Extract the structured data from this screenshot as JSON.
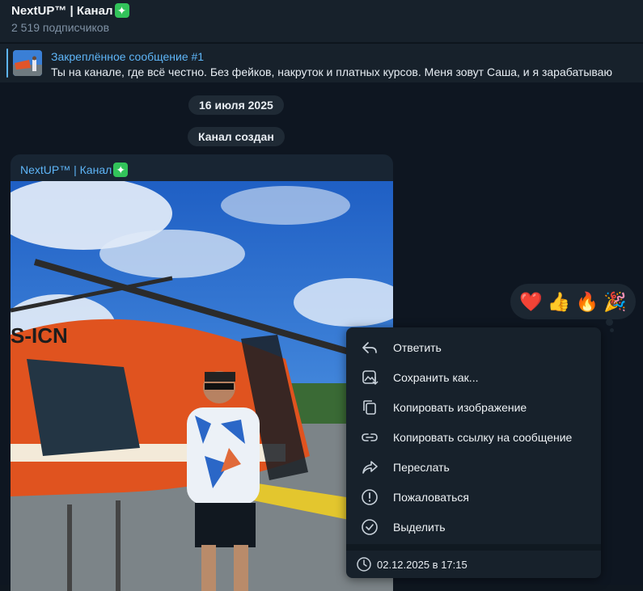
{
  "header": {
    "title": "NextUP™ | Канал",
    "title_emoji": "✦",
    "subscribers": "2 519 подписчиков"
  },
  "pinned": {
    "title": "Закреплённое сообщение #1",
    "text": "Ты на канале, где всё честно. Без фейков, накруток и платных курсов.  Меня зовут Саша, и я зарабатываю"
  },
  "service": {
    "date": "16 июля 2025",
    "created": "Канал создан"
  },
  "message": {
    "author": "NextUP™ | Канал",
    "author_emoji": "✦"
  },
  "reactions": [
    "❤️",
    "👍",
    "🔥",
    "🎉"
  ],
  "menu": {
    "items": [
      {
        "label": "Ответить",
        "icon": "reply-icon"
      },
      {
        "label": "Сохранить как...",
        "icon": "save-image-icon"
      },
      {
        "label": "Копировать изображение",
        "icon": "copy-icon"
      },
      {
        "label": "Копировать ссылку на сообщение",
        "icon": "link-icon"
      },
      {
        "label": "Переслать",
        "icon": "forward-icon"
      },
      {
        "label": "Пожаловаться",
        "icon": "report-icon"
      },
      {
        "label": "Выделить",
        "icon": "select-icon"
      }
    ],
    "footer": "02.12.2025 в 17:15"
  },
  "colors": {
    "accent": "#5eb5f7",
    "bg": "#0e1621",
    "panel": "#17212b",
    "bubble": "#182533"
  }
}
